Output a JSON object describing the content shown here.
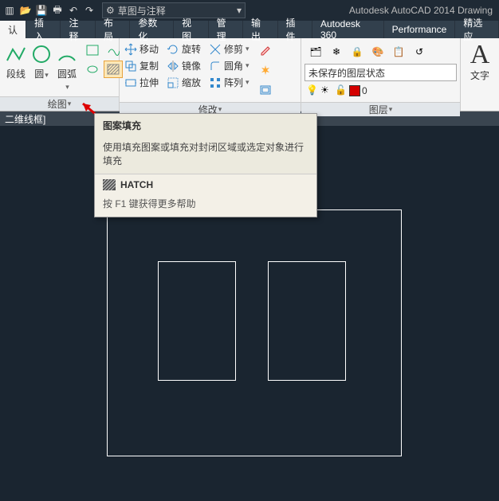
{
  "title": "Autodesk AutoCAD 2014   Drawing",
  "workspace": "草图与注释",
  "menus": [
    "认",
    "插入",
    "注释",
    "布局",
    "参数化",
    "视图",
    "管理",
    "输出",
    "插件",
    "Autodesk 360",
    "Performance",
    "精选应"
  ],
  "draw": {
    "panel": "绘图",
    "poly": "段线",
    "circle": "圆",
    "arc": "圆弧"
  },
  "modify": {
    "panel": "修改",
    "move": "移动",
    "copy": "复制",
    "stretch": "拉伸",
    "rotate": "旋转",
    "mirror": "镜像",
    "scale": "缩放",
    "trim": "修剪",
    "fillet": "圆角",
    "array": "阵列"
  },
  "layer": {
    "panel": "图层",
    "state": "未保存的图层状态",
    "cur": "0"
  },
  "ann": {
    "text": "文字"
  },
  "viewmode": "二维线框]",
  "tooltip": {
    "title": "图案填充",
    "desc": "使用填充图案或填充对封闭区域或选定对象进行填充",
    "cmd": "HATCH",
    "help": "按 F1 键获得更多帮助"
  }
}
